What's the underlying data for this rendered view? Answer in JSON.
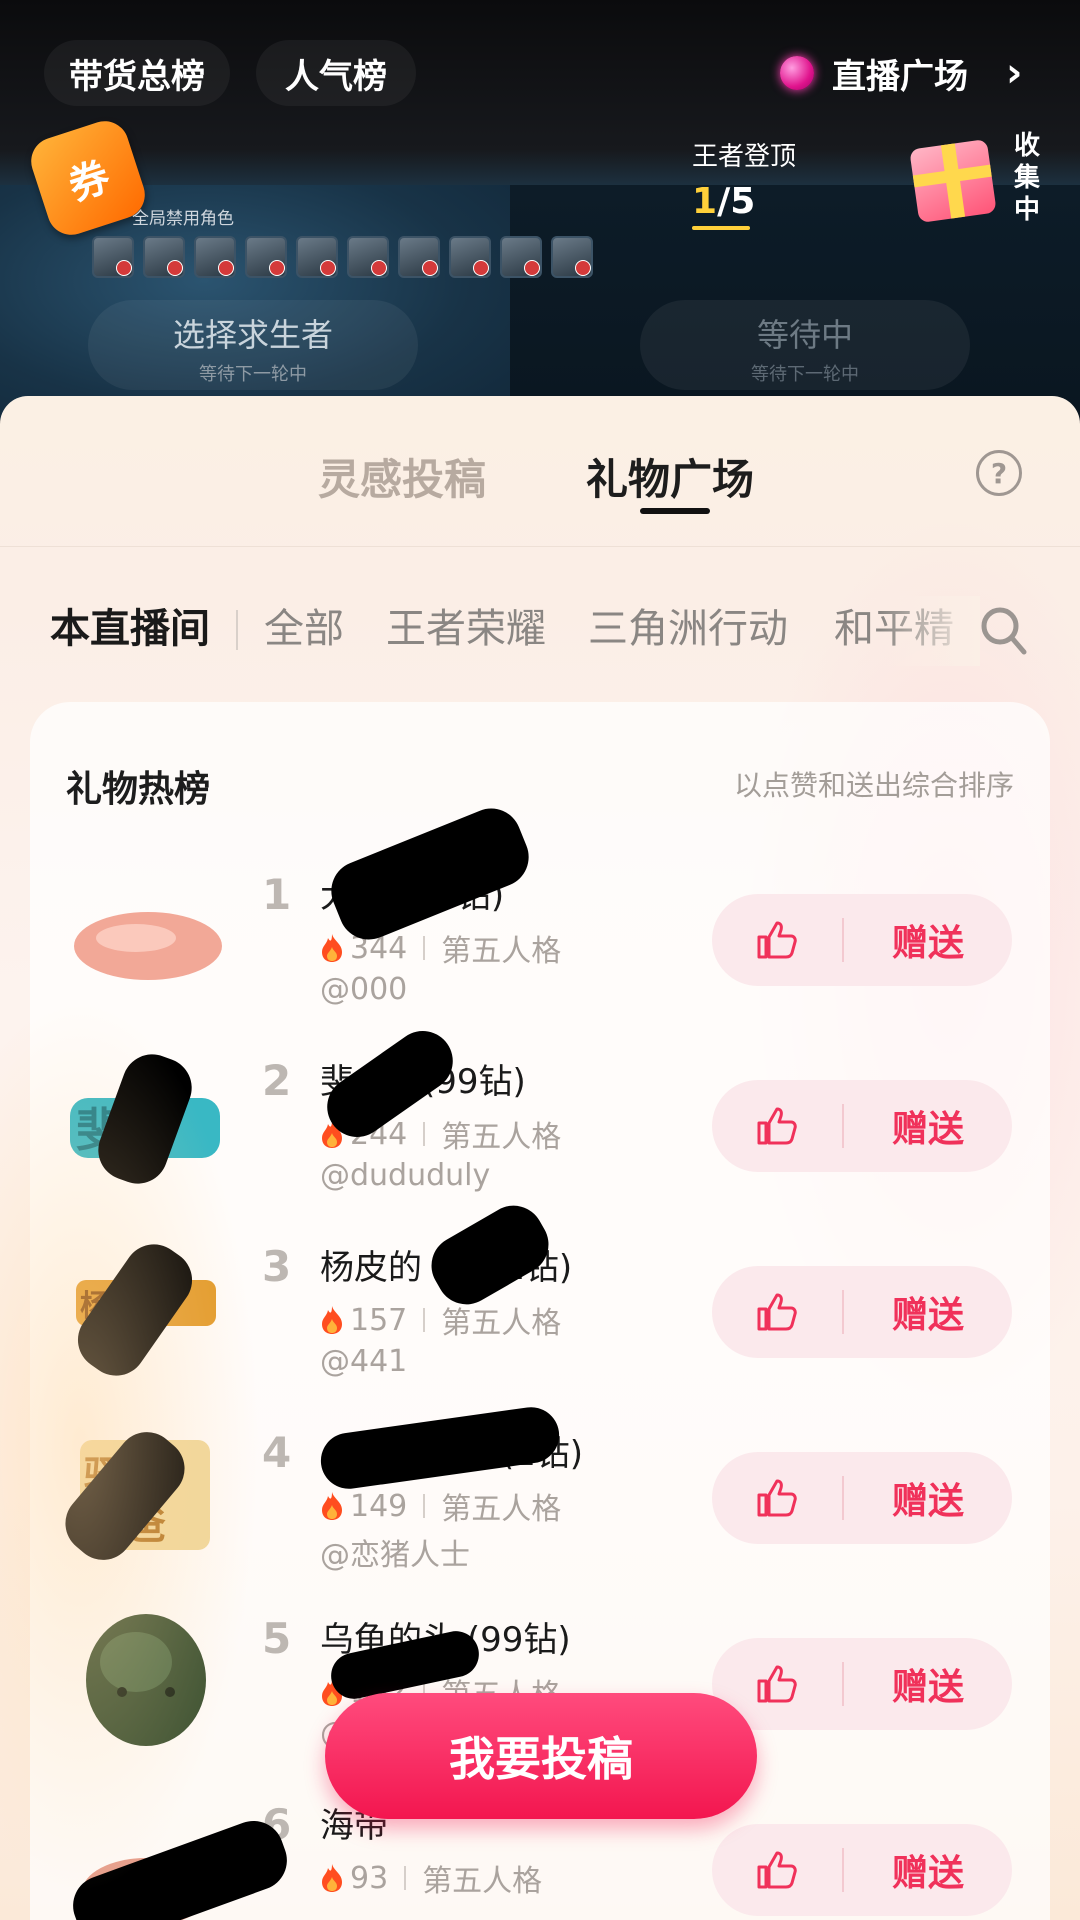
{
  "header": {
    "tab_sales": "带货总榜",
    "tab_popular": "人气榜",
    "live_plaza": "直播广场",
    "chevron": "›"
  },
  "game_overlay": {
    "coupon": "券",
    "ban_label": "全局禁用角色",
    "choose_title": "选择求生者",
    "choose_sub": "等待下一轮中",
    "waiting_title": "等待中",
    "waiting_sub": "等待下一轮中",
    "king_title": "王者登顶",
    "king_current": "1",
    "king_total": "/5",
    "collecting": "收集中"
  },
  "sheet": {
    "tab_inspiration": "灵感投稿",
    "tab_gift_plaza": "礼物广场",
    "help": "?"
  },
  "categories": [
    "本直播间",
    "全部",
    "王者荣耀",
    "三角洲行动",
    "和平精"
  ],
  "card": {
    "title": "礼物热榜",
    "subtitle": "以点赞和送出综合排序"
  },
  "gifts": [
    {
      "rank": "1",
      "name": "大",
      "price": "(1钻)",
      "heat": "344",
      "game": "第五人格",
      "user": "@000"
    },
    {
      "rank": "2",
      "name": "斐",
      "price": "(99钻)",
      "heat": "244",
      "game": "第五人格",
      "user": "@dududuly"
    },
    {
      "rank": "3",
      "name": "杨皮的",
      "price": "(1钻)",
      "heat": "157",
      "game": "第五人格",
      "user": "@441"
    },
    {
      "rank": "4",
      "name": "爸",
      "price": "(1钻)",
      "heat": "149",
      "game": "第五人格",
      "user": "@恋猪人士"
    },
    {
      "rank": "5",
      "name": "乌龟的头",
      "price": "(99钻)",
      "heat": "102",
      "game": "第五人格",
      "user": "@"
    },
    {
      "rank": "6",
      "name": "海带",
      "price": "",
      "heat": "93",
      "game": "第五人格",
      "user": ""
    }
  ],
  "send_label": "赠送",
  "submit_button": "我要投稿",
  "colors": {
    "accent": "#f0315a",
    "rank_gray": "#bdb7b2",
    "king_yellow": "#ffd03a"
  }
}
